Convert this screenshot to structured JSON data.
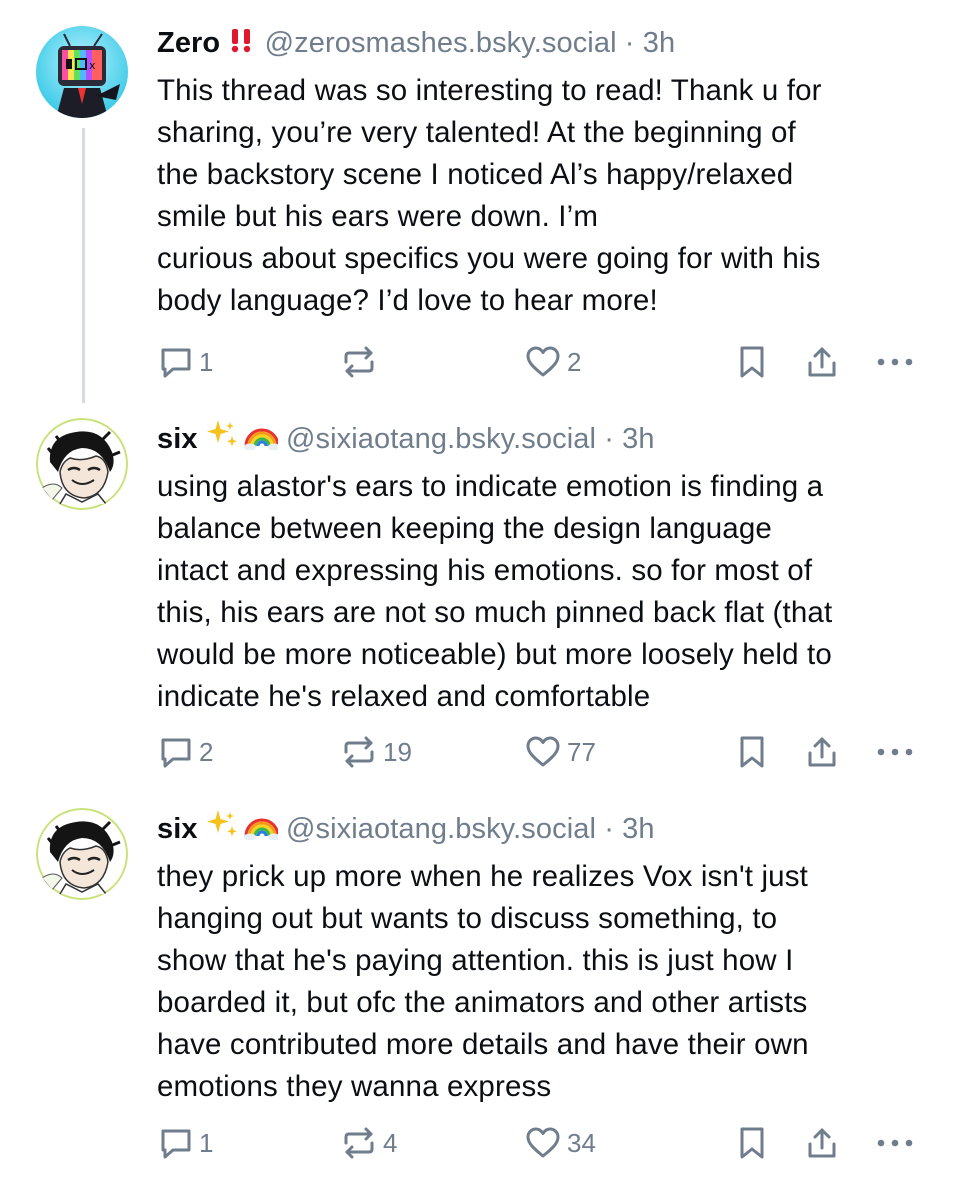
{
  "posts": [
    {
      "display_name": "Zero",
      "name_emoji": "‼️",
      "handle": "@zerosmashes.bsky.social",
      "separator": "·",
      "time": "3h",
      "lines": [
        "This thread was so interesting to read! Thank u for",
        "sharing, you’re very talented! At the beginning of",
        "the backstory scene I noticed Al’s happy/relaxed",
        "smile but his ears were down. I’m",
        "curious about specifics you were going for with his",
        "body language? I’d love to hear more!"
      ],
      "replies": "1",
      "reposts": "",
      "likes": "2"
    },
    {
      "display_name": "six",
      "name_emoji": "✨ 🌈",
      "handle": "@sixiaotang.bsky.social",
      "separator": "·",
      "time": "3h",
      "lines": [
        "using alastor's ears to indicate emotion is finding a",
        "balance between keeping the design language",
        "intact and expressing his emotions. so for most of",
        "this, his ears are not so much pinned back flat (that",
        "would be more noticeable) but more loosely held to",
        "indicate he's relaxed and comfortable"
      ],
      "replies": "2",
      "reposts": "19",
      "likes": "77"
    },
    {
      "display_name": "six",
      "name_emoji": "✨ 🌈",
      "handle": "@sixiaotang.bsky.social",
      "separator": "·",
      "time": "3h",
      "lines": [
        "they prick up more when he realizes Vox isn't just",
        "hanging out but wants to discuss something, to",
        "show that he's paying attention. this is just how I",
        "boarded it, but ofc the animators and other artists",
        "have contributed more details and have their own",
        "emotions they wanna express"
      ],
      "replies": "1",
      "reposts": "4",
      "likes": "34"
    }
  ],
  "icons": {
    "reply": "reply-bubble-icon",
    "repost": "repost-arrows-icon",
    "like": "heart-icon",
    "bookmark": "bookmark-icon",
    "share": "share-icon",
    "more": "more-dots-icon"
  },
  "colors": {
    "text": "#0b0f14",
    "muted": "#6f7d8c",
    "thread_line": "#d4dbe2",
    "background": "#ffffff"
  }
}
